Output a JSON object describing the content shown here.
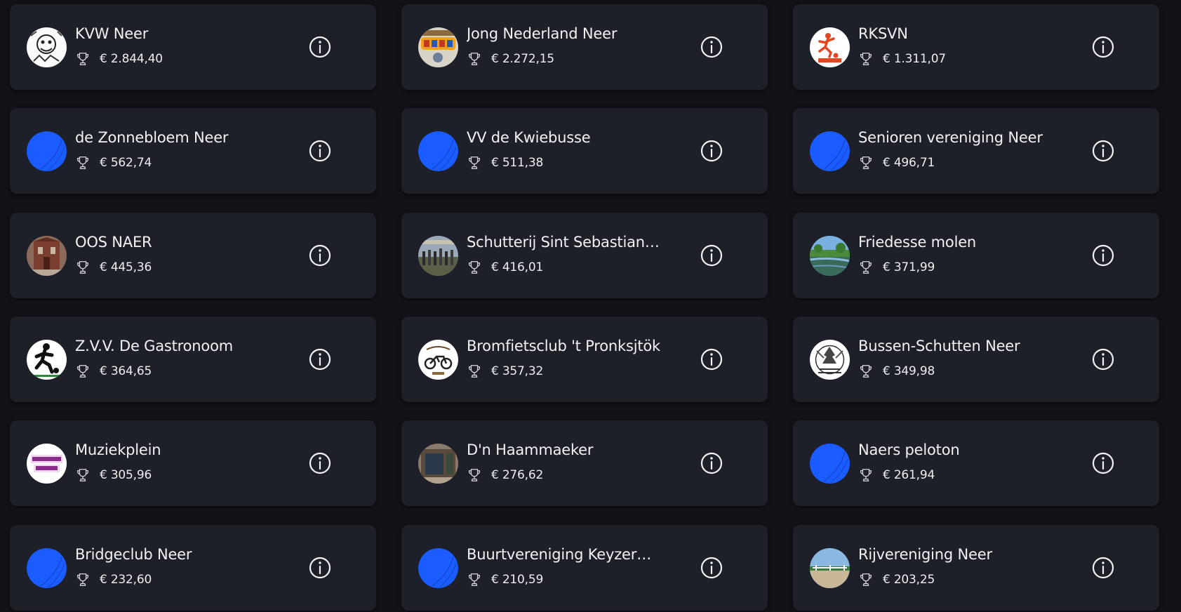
{
  "colors": {
    "background": "#121318",
    "card": "#1d1f29",
    "text": "#f2f2f4",
    "default_avatar": "#1a5cff"
  },
  "icons": {
    "amount": "trophy-icon",
    "action": "info-icon"
  },
  "clubs": [
    {
      "name": "KVW Neer",
      "amount": "€ 2.844,40",
      "avatar": "logo"
    },
    {
      "name": "Jong Nederland Neer",
      "amount": "€ 2.272,15",
      "avatar": "logo"
    },
    {
      "name": "RKSVN",
      "amount": "€ 1.311,07",
      "avatar": "logo"
    },
    {
      "name": "de Zonnebloem Neer",
      "amount": "€ 562,74",
      "avatar": "default"
    },
    {
      "name": "VV de Kwiebusse",
      "amount": "€ 511,38",
      "avatar": "default"
    },
    {
      "name": "Senioren vereniging Neer",
      "amount": "€ 496,71",
      "avatar": "default"
    },
    {
      "name": "OOS NAER",
      "amount": "€ 445,36",
      "avatar": "photo"
    },
    {
      "name": "Schutterij Sint Sebastian…",
      "amount": "€ 416,01",
      "avatar": "photo"
    },
    {
      "name": "Friedesse molen",
      "amount": "€ 371,99",
      "avatar": "photo"
    },
    {
      "name": "Z.V.V. De Gastronoom",
      "amount": "€ 364,65",
      "avatar": "logo"
    },
    {
      "name": "Bromfietsclub 't Pronksjtök",
      "amount": "€ 357,32",
      "avatar": "logo"
    },
    {
      "name": "Bussen-Schutten Neer",
      "amount": "€ 349,98",
      "avatar": "logo"
    },
    {
      "name": "Muziekplein",
      "amount": "€ 305,96",
      "avatar": "logo"
    },
    {
      "name": "D'n Haammaeker",
      "amount": "€ 276,62",
      "avatar": "photo"
    },
    {
      "name": "Naers peloton",
      "amount": "€ 261,94",
      "avatar": "default"
    },
    {
      "name": "Bridgeclub Neer",
      "amount": "€ 232,60",
      "avatar": "default"
    },
    {
      "name": "Buurtvereniging Keyzer…",
      "amount": "€ 210,59",
      "avatar": "default"
    },
    {
      "name": "Rijvereniging Neer",
      "amount": "€ 203,25",
      "avatar": "photo"
    }
  ]
}
